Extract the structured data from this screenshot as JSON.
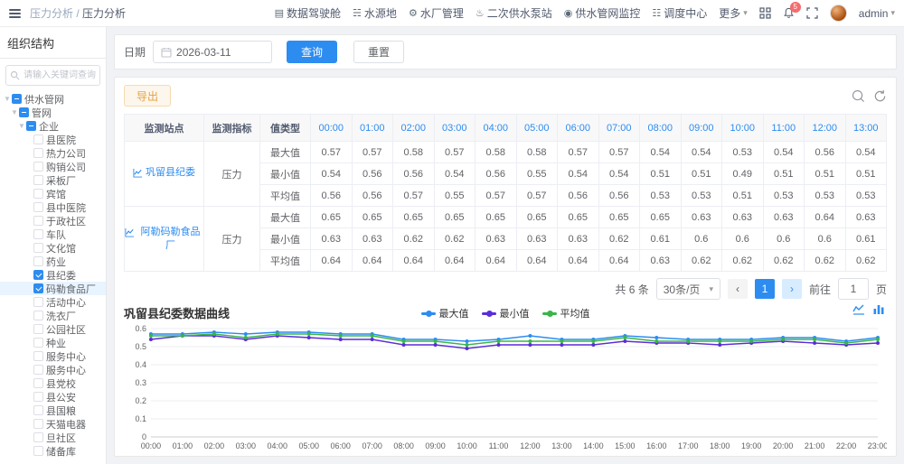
{
  "accent": "#2d8cf0",
  "header": {
    "breadcrumb": [
      "压力分析",
      "压力分析"
    ],
    "nav": [
      {
        "label": "数据驾驶舱",
        "icon": "dashboard-icon",
        "glyph": "▤"
      },
      {
        "label": "水源地",
        "icon": "water-source-icon",
        "glyph": "☵"
      },
      {
        "label": "水厂管理",
        "icon": "water-plant-icon",
        "glyph": "⚙"
      },
      {
        "label": "二次供水泵站",
        "icon": "pump-station-icon",
        "glyph": "♨"
      },
      {
        "label": "供水管网监控",
        "icon": "pipe-monitor-icon",
        "glyph": "◉"
      },
      {
        "label": "调度中心",
        "icon": "dispatch-center-icon",
        "glyph": "☷"
      },
      {
        "label": "更多",
        "icon": "more-menu",
        "glyph": "▾"
      }
    ],
    "notification_count": "5",
    "user": "admin"
  },
  "sidebar": {
    "title": "组织结构",
    "search_placeholder": "请输入关键词查询",
    "tree": [
      {
        "label": "供水管网",
        "level": 0,
        "caret": true,
        "state": "ind"
      },
      {
        "label": "管网",
        "level": 1,
        "caret": true,
        "state": "ind"
      },
      {
        "label": "企业",
        "level": 2,
        "caret": true,
        "state": "ind"
      },
      {
        "label": "县医院",
        "level": 3,
        "state": "none"
      },
      {
        "label": "热力公司",
        "level": 3,
        "state": "none"
      },
      {
        "label": "购销公司",
        "level": 3,
        "state": "none"
      },
      {
        "label": "采板厂",
        "level": 3,
        "state": "none"
      },
      {
        "label": "宾馆",
        "level": 3,
        "state": "none"
      },
      {
        "label": "县中医院",
        "level": 3,
        "state": "none"
      },
      {
        "label": "于政社区",
        "level": 3,
        "state": "none"
      },
      {
        "label": "车队",
        "level": 3,
        "state": "none"
      },
      {
        "label": "文化馆",
        "level": 3,
        "state": "none"
      },
      {
        "label": "药业",
        "level": 3,
        "state": "none"
      },
      {
        "label": "县纪委",
        "level": 3,
        "state": "checked"
      },
      {
        "label": "码勒食品厂",
        "level": 3,
        "state": "checked",
        "selected": true
      },
      {
        "label": "活动中心",
        "level": 3,
        "state": "none"
      },
      {
        "label": "洗衣厂",
        "level": 3,
        "state": "none"
      },
      {
        "label": "公园社区",
        "level": 3,
        "state": "none"
      },
      {
        "label": "种业",
        "level": 3,
        "state": "none"
      },
      {
        "label": "服务中心",
        "level": 3,
        "state": "none"
      },
      {
        "label": "服务中心",
        "level": 3,
        "state": "none"
      },
      {
        "label": "县党校",
        "level": 3,
        "state": "none"
      },
      {
        "label": "县公安",
        "level": 3,
        "state": "none"
      },
      {
        "label": "县国粮",
        "level": 3,
        "state": "none"
      },
      {
        "label": "天猫电器",
        "level": 3,
        "state": "none"
      },
      {
        "label": "旦社区",
        "level": 3,
        "state": "none"
      },
      {
        "label": "储备库",
        "level": 3,
        "state": "none"
      }
    ]
  },
  "filters": {
    "date_label": "日期",
    "date_value": "2026-03-11",
    "search_button": "查询",
    "reset_button": "重置"
  },
  "toolbar": {
    "export_button": "导出"
  },
  "table": {
    "headers": {
      "station": "监测站点",
      "indicator": "监测指标",
      "value_type": "值类型"
    },
    "hours": [
      "00:00",
      "01:00",
      "02:00",
      "03:00",
      "04:00",
      "05:00",
      "06:00",
      "07:00",
      "08:00",
      "09:00",
      "10:00",
      "11:00",
      "12:00",
      "13:00"
    ],
    "groups": [
      {
        "station": "巩留县纪委",
        "indicator": "压力",
        "rows": [
          {
            "type": "最大值",
            "values": [
              "0.57",
              "0.57",
              "0.58",
              "0.57",
              "0.58",
              "0.58",
              "0.57",
              "0.57",
              "0.54",
              "0.54",
              "0.53",
              "0.54",
              "0.56",
              "0.54"
            ]
          },
          {
            "type": "最小值",
            "values": [
              "0.54",
              "0.56",
              "0.56",
              "0.54",
              "0.56",
              "0.55",
              "0.54",
              "0.54",
              "0.51",
              "0.51",
              "0.49",
              "0.51",
              "0.51",
              "0.51"
            ]
          },
          {
            "type": "平均值",
            "values": [
              "0.56",
              "0.56",
              "0.57",
              "0.55",
              "0.57",
              "0.57",
              "0.56",
              "0.56",
              "0.53",
              "0.53",
              "0.51",
              "0.53",
              "0.53",
              "0.53"
            ]
          }
        ]
      },
      {
        "station": "阿勒码勒食品厂",
        "indicator": "压力",
        "rows": [
          {
            "type": "最大值",
            "values": [
              "0.65",
              "0.65",
              "0.65",
              "0.65",
              "0.65",
              "0.65",
              "0.65",
              "0.65",
              "0.65",
              "0.63",
              "0.63",
              "0.63",
              "0.64",
              "0.63"
            ]
          },
          {
            "type": "最小值",
            "values": [
              "0.63",
              "0.63",
              "0.62",
              "0.62",
              "0.63",
              "0.63",
              "0.63",
              "0.62",
              "0.61",
              "0.6",
              "0.6",
              "0.6",
              "0.6",
              "0.61"
            ]
          },
          {
            "type": "平均值",
            "values": [
              "0.64",
              "0.64",
              "0.64",
              "0.64",
              "0.64",
              "0.64",
              "0.64",
              "0.64",
              "0.63",
              "0.62",
              "0.62",
              "0.62",
              "0.62",
              "0.62"
            ]
          }
        ]
      }
    ]
  },
  "pagination": {
    "total": "共 6 条",
    "page_size": "30条/页",
    "prev": "‹",
    "current": "1",
    "next": "›",
    "goto_label": "前往",
    "goto_value": "1",
    "unit": "页"
  },
  "chart_data": {
    "type": "line",
    "title": "巩留县纪委数据曲线",
    "x": [
      "00:00",
      "01:00",
      "02:00",
      "03:00",
      "04:00",
      "05:00",
      "06:00",
      "07:00",
      "08:00",
      "09:00",
      "10:00",
      "11:00",
      "12:00",
      "13:00",
      "14:00",
      "15:00",
      "16:00",
      "17:00",
      "18:00",
      "19:00",
      "20:00",
      "21:00",
      "22:00",
      "23:00"
    ],
    "ylim": [
      0,
      0.6
    ],
    "yticks": [
      0,
      0.1,
      0.2,
      0.3,
      0.4,
      0.5,
      0.6
    ],
    "grid": true,
    "legend_position": "top",
    "series": [
      {
        "name": "最大值",
        "color": "#2d8cf0",
        "values": [
          0.57,
          0.57,
          0.58,
          0.57,
          0.58,
          0.58,
          0.57,
          0.57,
          0.54,
          0.54,
          0.53,
          0.54,
          0.56,
          0.54,
          0.54,
          0.56,
          0.55,
          0.54,
          0.54,
          0.54,
          0.55,
          0.55,
          0.53,
          0.55
        ]
      },
      {
        "name": "最小值",
        "color": "#5b2cd9",
        "values": [
          0.54,
          0.56,
          0.56,
          0.54,
          0.56,
          0.55,
          0.54,
          0.54,
          0.51,
          0.51,
          0.49,
          0.51,
          0.51,
          0.51,
          0.51,
          0.53,
          0.52,
          0.52,
          0.51,
          0.52,
          0.53,
          0.52,
          0.51,
          0.52
        ]
      },
      {
        "name": "平均值",
        "color": "#39b54a",
        "values": [
          0.56,
          0.56,
          0.57,
          0.55,
          0.57,
          0.57,
          0.56,
          0.56,
          0.53,
          0.53,
          0.51,
          0.53,
          0.53,
          0.53,
          0.53,
          0.55,
          0.53,
          0.53,
          0.53,
          0.53,
          0.54,
          0.54,
          0.52,
          0.54
        ]
      }
    ]
  }
}
